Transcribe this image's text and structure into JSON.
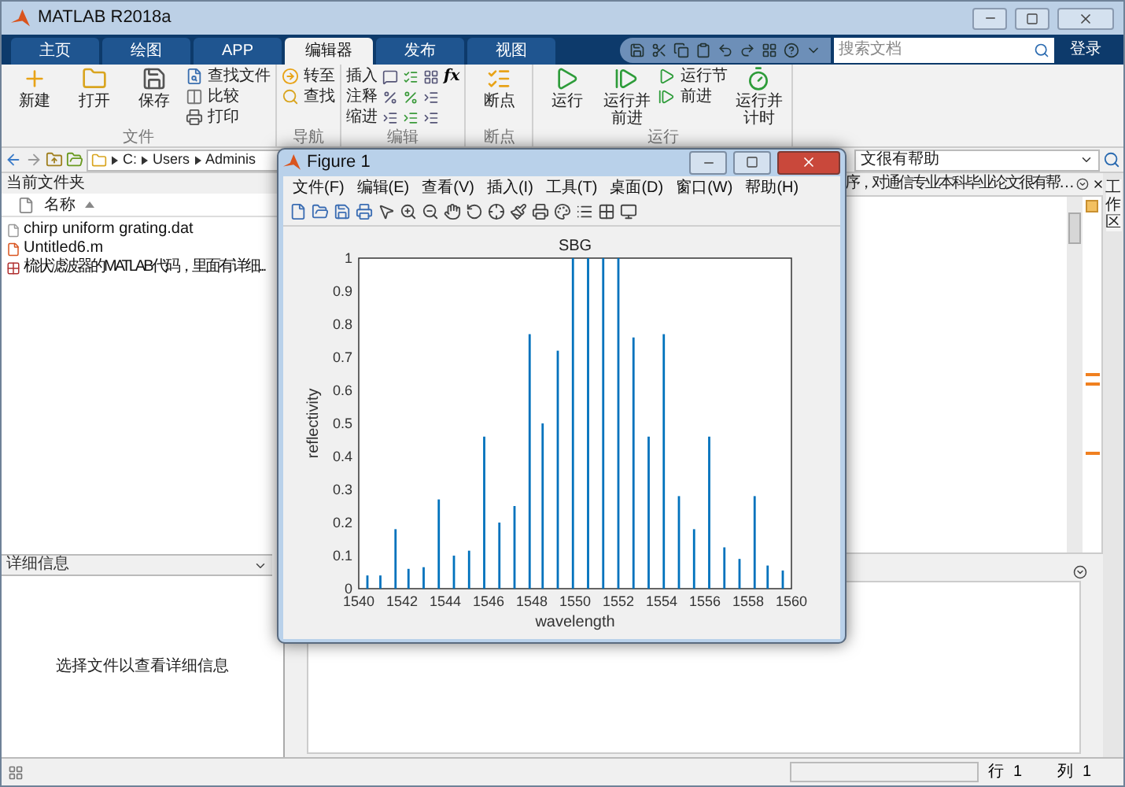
{
  "window": {
    "title": "MATLAB R2018a"
  },
  "tabs": [
    {
      "label": "主页",
      "selected": false
    },
    {
      "label": "绘图",
      "selected": false
    },
    {
      "label": "APP",
      "selected": false
    },
    {
      "label": "编辑器",
      "selected": true
    },
    {
      "label": "发布",
      "selected": false
    },
    {
      "label": "视图",
      "selected": false
    }
  ],
  "search": {
    "placeholder": "搜索文档"
  },
  "sign_in": "登录",
  "toolstrip": {
    "groups": [
      {
        "label": "文件",
        "buttons": [
          {
            "label": "新建",
            "kind": "large"
          },
          {
            "label": "打开",
            "kind": "large"
          },
          {
            "label": "保存",
            "kind": "large"
          },
          {
            "label": "查找文件",
            "kind": "small"
          },
          {
            "label": "比较",
            "kind": "small"
          },
          {
            "label": "打印",
            "kind": "small"
          }
        ]
      },
      {
        "label": "导航",
        "buttons": [
          {
            "label": "转至",
            "kind": "small"
          },
          {
            "label": "查找",
            "kind": "small"
          }
        ]
      },
      {
        "label": "编辑",
        "buttons": [
          {
            "label": "插入",
            "kind": "text"
          },
          {
            "label": "注释",
            "kind": "text"
          },
          {
            "label": "缩进",
            "kind": "text"
          }
        ]
      },
      {
        "label": "断点",
        "buttons": [
          {
            "label": "断点",
            "kind": "large"
          }
        ]
      },
      {
        "label": "运行",
        "buttons": [
          {
            "label": "运行",
            "kind": "large"
          },
          {
            "label": "运行并前进",
            "kind": "large"
          },
          {
            "label": "运行节",
            "kind": "small"
          },
          {
            "label": "前进",
            "kind": "small"
          },
          {
            "label": "运行并计时",
            "kind": "large"
          }
        ]
      }
    ],
    "function_symbol": "fx"
  },
  "address_bar": {
    "path": [
      "C:",
      "Users",
      "Adminis"
    ],
    "combo_value": "文很有帮助"
  },
  "current_folder": {
    "title": "当前文件夹",
    "column": "名称",
    "files": [
      {
        "name": "chirp uniform grating.dat",
        "kind": "dat"
      },
      {
        "name": "Untitled6.m",
        "kind": "m"
      },
      {
        "name": "梳状滤波器的MATLAB代码，里面有详细...",
        "kind": "rar"
      }
    ]
  },
  "details": {
    "title": "详细信息",
    "message": "选择文件以查看详细信息"
  },
  "editor": {
    "tab_title": "序，对通信专业本科毕业论文很有帮…"
  },
  "workspace_tab": "工作区",
  "status_bar": {
    "row_label": "行",
    "row": "1",
    "col_label": "列",
    "col": "1"
  },
  "figure": {
    "title": "Figure 1",
    "menus": [
      "文件(F)",
      "编辑(E)",
      "查看(V)",
      "插入(I)",
      "工具(T)",
      "桌面(D)",
      "窗口(W)",
      "帮助(H)"
    ],
    "chart_data": {
      "type": "bar",
      "title": "SBG",
      "xlabel": "wavelength",
      "ylabel": "reflectivity",
      "xlim": [
        1540,
        1560
      ],
      "ylim": [
        0,
        1
      ],
      "xticks": [
        1540,
        1542,
        1544,
        1546,
        1548,
        1550,
        1552,
        1554,
        1556,
        1558,
        1560
      ],
      "yticks": [
        0,
        0.1,
        0.2,
        0.3,
        0.4,
        0.5,
        0.6,
        0.7,
        0.8,
        0.9,
        1
      ],
      "x": [
        1540.4,
        1541.0,
        1541.7,
        1542.3,
        1543.0,
        1543.7,
        1544.4,
        1545.1,
        1545.8,
        1546.5,
        1547.2,
        1547.9,
        1548.5,
        1549.2,
        1549.9,
        1550.6,
        1551.3,
        1552.0,
        1552.7,
        1553.4,
        1554.1,
        1554.8,
        1555.5,
        1556.2,
        1556.9,
        1557.6,
        1558.3,
        1558.9,
        1559.6
      ],
      "series": [
        {
          "color": "#0072bd",
          "values": [
            0.04,
            0.04,
            0.18,
            0.06,
            0.065,
            0.27,
            0.1,
            0.115,
            0.46,
            0.2,
            0.25,
            0.77,
            0.5,
            0.72,
            1,
            1,
            1,
            1,
            0.76,
            0.46,
            0.77,
            0.28,
            0.18,
            0.46,
            0.125,
            0.09,
            0.28,
            0.07,
            0.055
          ]
        }
      ]
    }
  }
}
